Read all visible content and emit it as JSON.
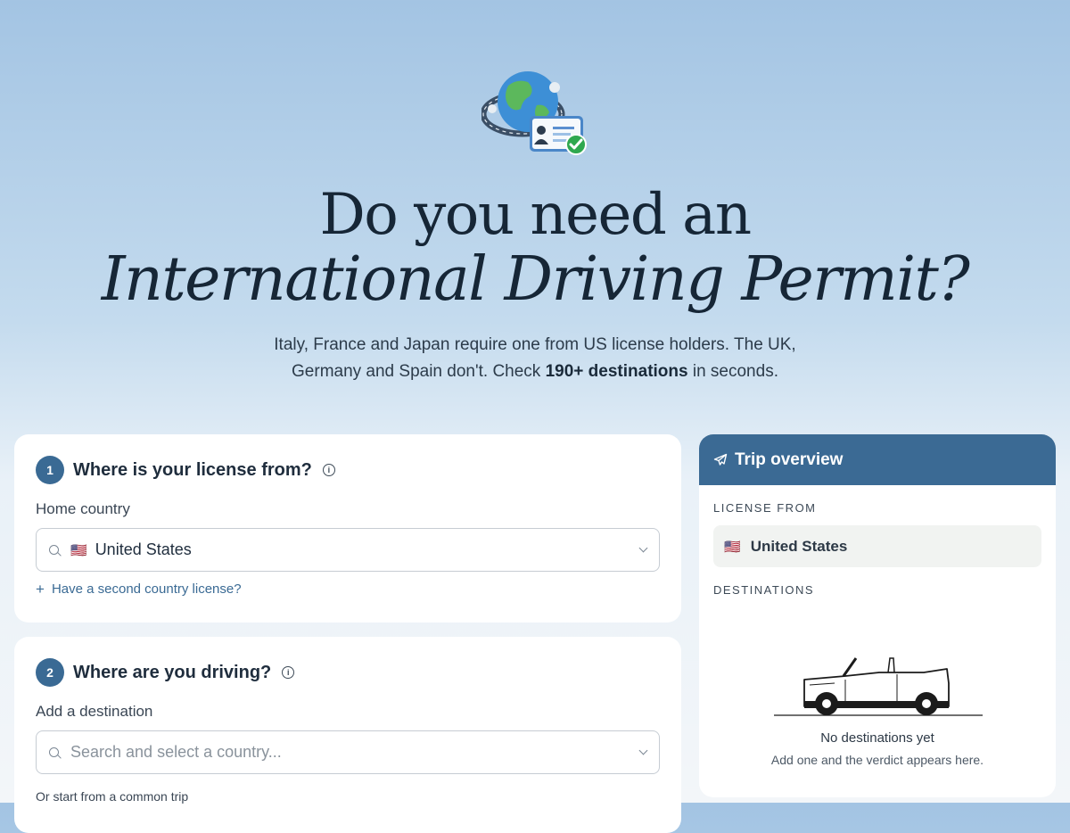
{
  "hero": {
    "title_line1": "Do you need an",
    "title_line2": "International Driving Permit?",
    "subtitle_part1": "Italy, France and Japan require one from US license holders. The UK, Germany and Spain don't. Check ",
    "subtitle_bold": "190+ destinations",
    "subtitle_part2": " in seconds.",
    "icon": "globe-license-icon"
  },
  "step1": {
    "number": "1",
    "title": "Where is your license from?",
    "field_label": "Home country",
    "flag": "🇺🇸",
    "value": "United States",
    "add_link": "Have a second country license?"
  },
  "step2": {
    "number": "2",
    "title": "Where are you driving?",
    "field_label": "Add a destination",
    "placeholder": "Search and select a country...",
    "common_label": "Or start from a common trip"
  },
  "overview": {
    "title": "Trip overview",
    "license_label": "LICENSE FROM",
    "flag": "🇺🇸",
    "license_value": "United States",
    "destinations_label": "DESTINATIONS",
    "empty_title": "No destinations yet",
    "empty_sub": "Add one and the verdict appears here."
  },
  "colors": {
    "accent": "#3b6a94",
    "hero_top": "#a3c4e3",
    "background": "#f3f6f9"
  }
}
